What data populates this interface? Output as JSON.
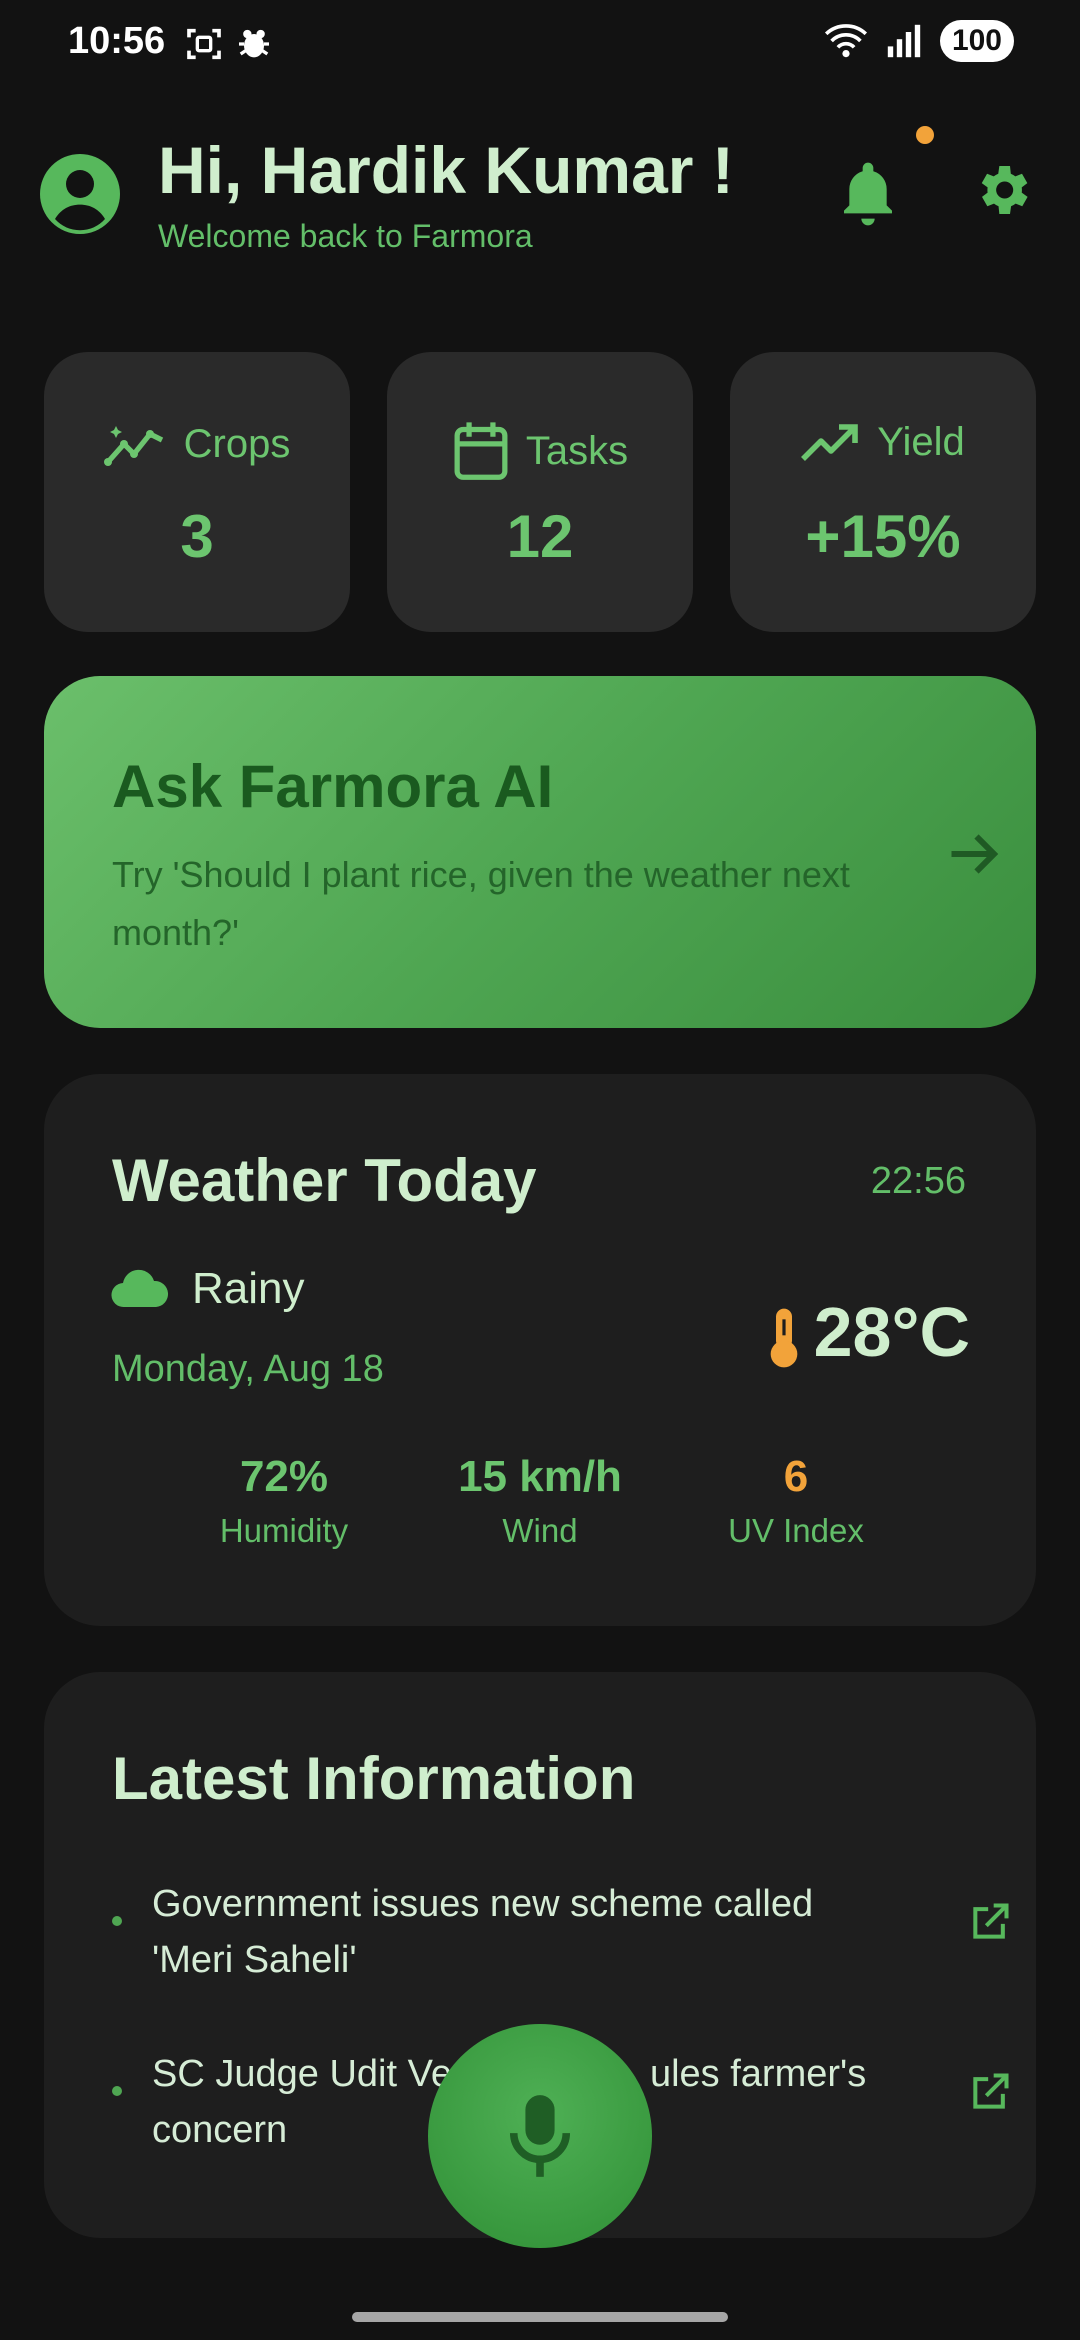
{
  "status_bar": {
    "time": "10:56",
    "battery": "100",
    "icons": [
      "screenshot-icon",
      "bug-icon",
      "wifi-icon",
      "signal-icon",
      "battery-icon"
    ]
  },
  "header": {
    "greeting": "Hi, Hardik Kumar !",
    "subtitle": "Welcome back to Farmora",
    "icons": [
      "account-icon",
      "bell-icon",
      "gear-icon"
    ],
    "notification_dot_color": "#f2a33a"
  },
  "stats": [
    {
      "label": "Crops",
      "value": "3",
      "icon": "sparkline-icon"
    },
    {
      "label": "Tasks",
      "value": "12",
      "icon": "calendar-icon"
    },
    {
      "label": "Yield",
      "value": "+15%",
      "icon": "trending-up-icon"
    }
  ],
  "ai_card": {
    "title": "Ask Farmora AI",
    "subtitle": "Try 'Should I plant rice, given the weather next month?'",
    "icon": "arrow-right-icon"
  },
  "weather": {
    "title": "Weather Today",
    "time": "22:56",
    "condition": "Rainy",
    "condition_icon": "cloud-icon",
    "date": "Monday, Aug 18",
    "temperature": "28°C",
    "temperature_icon": "thermometer-icon",
    "stats": [
      {
        "value": "72%",
        "label": "Humidity"
      },
      {
        "value": "15 km/h",
        "label": "Wind"
      },
      {
        "value": "6",
        "label": "UV Index",
        "color": "#f2a33a"
      }
    ]
  },
  "latest_info": {
    "title": "Latest Information",
    "items": [
      {
        "text": "Government issues new scheme called 'Meri Saheli'",
        "icon": "external-link-icon"
      },
      {
        "text": "SC Judge Udit Ve... ...ules farmer's concern",
        "visible_line1": "SC Judge Udit Ve",
        "visible_line1b": "ules farmer's",
        "visible_line2": "concern",
        "icon": "external-link-icon"
      }
    ]
  },
  "fab": {
    "icon": "mic-icon"
  },
  "colors": {
    "background": "#121212",
    "card": "#2a2a2a",
    "accent": "#6cc56f",
    "text": "#cfeecd"
  }
}
